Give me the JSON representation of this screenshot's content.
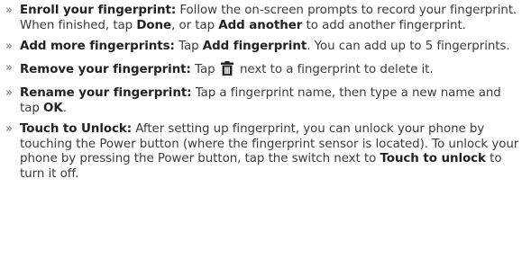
{
  "bullet": "»",
  "items": [
    {
      "title": "Enroll your fingerprint:",
      "t1": " Follow the on-screen prompts to record your fingerprint. When finished, tap ",
      "b1": "Done",
      "t2": ", or tap ",
      "b2": "Add another",
      "t3": " to add another fingerprint."
    },
    {
      "title": "Add more fingerprints:",
      "t1": " Tap ",
      "b1": "Add fingerprint",
      "t2": ". You can add up to 5 fingerprints."
    },
    {
      "title": "Remove your fingerprint:",
      "t1": " Tap ",
      "icon": "trash-icon",
      "t2": " next to a fingerprint to delete it."
    },
    {
      "title": "Rename your fingerprint:",
      "t1": " Tap a fingerprint name, then type a new name and tap ",
      "b1": "OK",
      "t2": "."
    },
    {
      "title": "Touch to Unlock:",
      "t1": " After setting up fingerprint, you can unlock your phone by touching the Power button (where the fingerprint sensor is located). To unlock your phone by pressing the Power button, tap the switch next to ",
      "b1": "Touch to unlock",
      "t2": " to turn it off."
    }
  ]
}
